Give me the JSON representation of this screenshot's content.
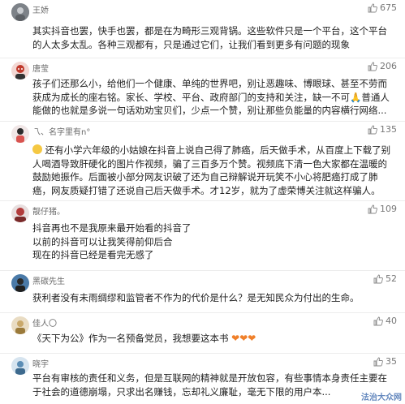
{
  "comments": [
    {
      "name": "王娇",
      "likes": "675",
      "lines": [
        "其实抖音也罢，快手也罢，都是在为畸形三观背锅。这些软件只是一个平台，这个平台",
        "的人太多太乱。各种三观都有，只是通过它们，让我们看到更多有问题的现象"
      ],
      "avatar_color": "#8a8f95"
    },
    {
      "name": "唐莹",
      "likes": "206",
      "lines": [
        "孩子们还那么小，给他们一个健康、单纯的世界吧，别让恶趣味、博眼球、甚至不劳而",
        "获成为成长的座右铭。家长、学校、平台、政府部门的支持和关注，缺一不可🙏普通人",
        "能做的也就是多说一句话劝劝宝贝们，少点一个赞，别让那些负能量的内容横行网络..."
      ],
      "avatar_color": "#c0392b"
    },
    {
      "name": "乁、名字里有n°",
      "likes": "135",
      "lines": [
        "还有小学六年级的小姑娘在抖音上说自己得了肺癌，后天做手术，从百度上下载了别",
        "人喝酒导致肝硬化的图片作视频，骗了三百多万个赞。视频底下清一色大家都在温暖的",
        "鼓励她振作。后面被小部分网友识破了还为自己辩解说开玩笑不小心将肥癌打成了肺",
        "癌，网友质疑打错了还说自己后天做手术。才12岁，就为了虚荣博关注就这样骗人。"
      ],
      "avatar_color": "#d9534f"
    },
    {
      "name": "靓仔猪。",
      "likes": "109",
      "lines": [
        "抖音再也不是我原来最开始看的抖音了",
        "以前的抖音可以让我笑得前仰后合",
        "现在的抖音已经是看完无感了"
      ],
      "avatar_color": "#b23b3b"
    },
    {
      "name": "黑碳先生",
      "likes": "52",
      "lines": [
        "获利者没有未雨绸缪和监管者不作为的代价是什么？是无知民众为付出的生命。"
      ],
      "avatar_color": "#4a7aa8"
    },
    {
      "name": "佳人〇",
      "likes": "40",
      "lines": [
        "《天下为公》作为一名预备党员，我想要这本书"
      ],
      "avatar_color": "#c9a86a"
    },
    {
      "name": "晓宇",
      "likes": "35",
      "lines": [
        "平台有审核的责任和义务，但是互联网的精神就是开放包容，有些事情本身责任主要在",
        "于社会的道德崩塌，只求出名赚钱，忘却礼义廉耻，毫无下限的用户本..."
      ],
      "avatar_color": "#5b8db5"
    }
  ],
  "watermark": "法治大众网",
  "colors": {
    "like_icon": "#888888",
    "name": "#6b6b6b",
    "heart": "#f0802a"
  },
  "icons": {
    "like": "thumbs-up-icon",
    "emoji": "smile-emoji-icon",
    "heart": "heart-icon"
  }
}
